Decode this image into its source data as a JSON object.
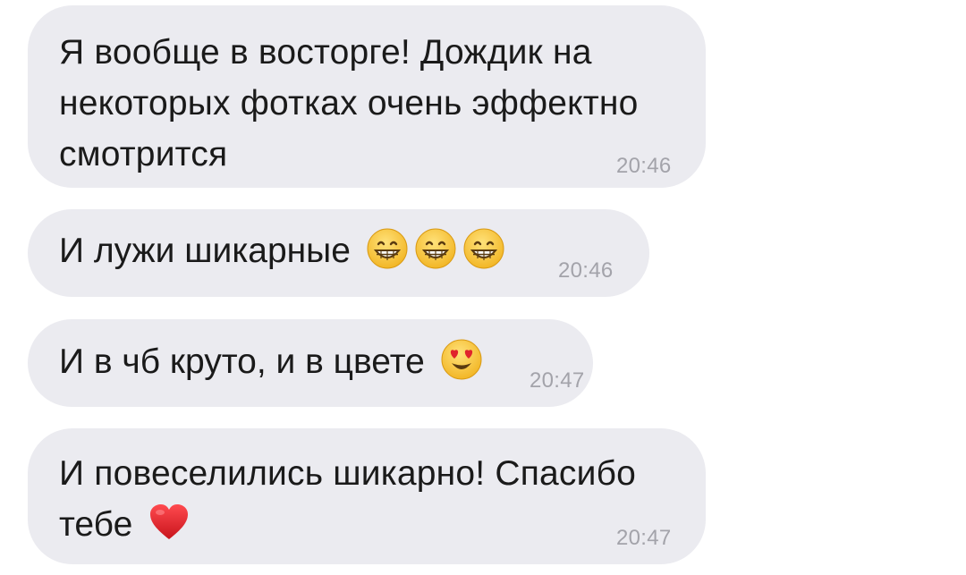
{
  "messages": [
    {
      "text": "Я вообще в восторге! Дождик на\nнекоторых фотках очень эффектно\nсмотрится",
      "time": "20:46"
    },
    {
      "text": "И лужи шикарные",
      "emoji": [
        "grinning-face",
        "grinning-face",
        "grinning-face"
      ],
      "time": "20:46"
    },
    {
      "text": "И в чб круто, и в цвете",
      "emoji": [
        "heart-eyes-face"
      ],
      "time": "20:47"
    },
    {
      "text_line1": "И повеселились шикарно! Спасибо",
      "text_line2": "тебе",
      "emoji": [
        "red-heart"
      ],
      "time": "20:47"
    }
  ],
  "colors": {
    "bubble": "#ebebf0",
    "text": "#1a1a1a",
    "time": "#a3a3aa",
    "emoji_face": "#f7c531",
    "heart": "#e0242c"
  }
}
